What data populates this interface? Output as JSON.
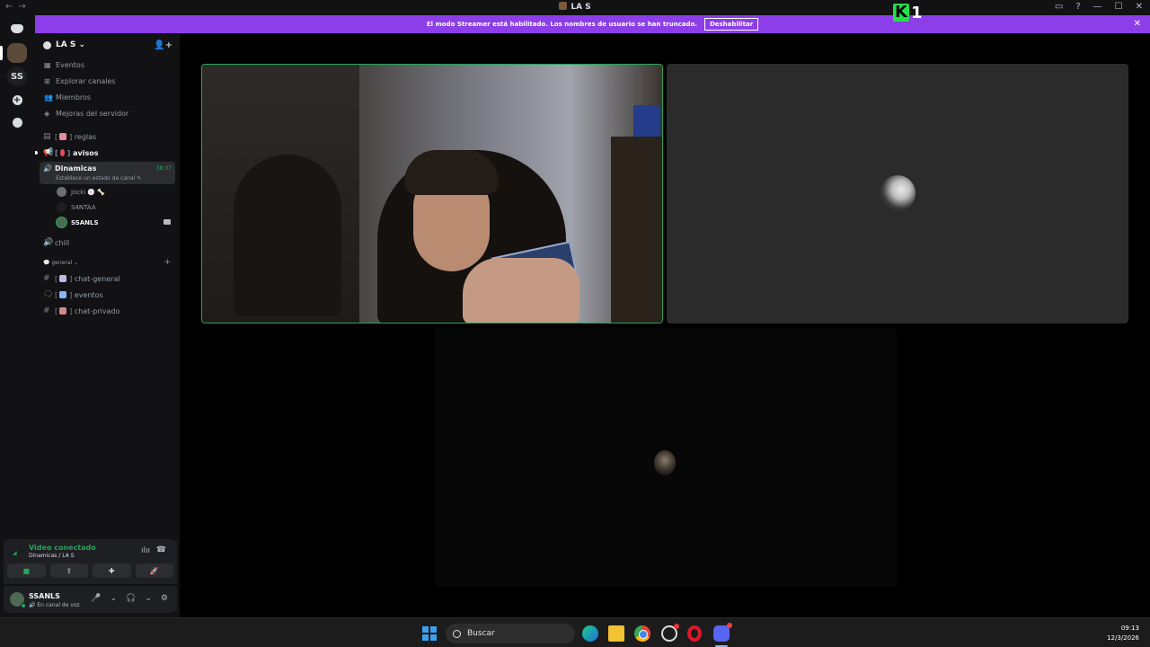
{
  "window": {
    "title": "LA S",
    "nav_back": "←",
    "nav_forward": "→",
    "controls": [
      "▭",
      "?",
      "—",
      "☐",
      "✕"
    ]
  },
  "overlay": {
    "k_letter": "K",
    "number": "1"
  },
  "banner": {
    "text": "El modo Streamer está habilitado. Los nombres de usuario se han truncado.",
    "button_label": "Deshabilitar",
    "close": "✕"
  },
  "rail": {
    "ss_label": "SS"
  },
  "server": {
    "name": "LA S ⌄",
    "invite_icon": "👤+"
  },
  "menu": [
    {
      "icon": "▦",
      "label": "Eventos"
    },
    {
      "icon": "⊞",
      "label": "Explorar canales"
    },
    {
      "icon": "👥",
      "label": "Miembros"
    },
    {
      "icon": "◈",
      "label": "Mejoras del servidor"
    }
  ],
  "channels_top": [
    {
      "icon": "▤",
      "label": "reglas",
      "emoji_color": "#e88aa0",
      "bold": false
    },
    {
      "icon": "📢",
      "label": "avisos",
      "emoji_color": "#e84a5f",
      "bold": true
    }
  ],
  "voice_channel": {
    "name": "Dinamicas",
    "status": "Establece un estado de canal ✎",
    "time": "38:37",
    "speaker_icon": "🔊",
    "users": [
      {
        "name": "Jocki 🍥 🦴"
      },
      {
        "name": "S4NTAA"
      },
      {
        "name": "SSANLS"
      }
    ]
  },
  "channel_chill": {
    "icon": "🔊",
    "label": "chill"
  },
  "category": {
    "label": "💬 general ⌄",
    "plus": "+"
  },
  "channels_general": [
    {
      "icon": "#",
      "label": "chat-general",
      "emoji_color": "#c4b7e8"
    },
    {
      "icon": "🗨",
      "label": "eventos",
      "emoji_color": "#8ab4f8"
    },
    {
      "icon": "#",
      "label": "chat-privado",
      "emoji_color": "#d08a8a"
    }
  ],
  "voice_panel": {
    "status": "Video conectado",
    "location": "Dinamicas / LA S",
    "noise_icon": "ılıı",
    "hangup_icon": "☎",
    "buttons": [
      "■",
      "⇪",
      "✚",
      "🚀"
    ]
  },
  "user_panel": {
    "name": "SSANLS",
    "status": "🔊 En canal de voz",
    "controls": [
      "🎤",
      "⌄",
      "🎧",
      "⌄",
      "⚙"
    ]
  },
  "taskbar": {
    "search": "Buscar",
    "time": "09:13",
    "date": "12/3/2026"
  },
  "colors": {
    "accent_green": "#23a55a",
    "banner_purple": "#8c3ee8",
    "discord_blurple": "#5865f2"
  }
}
